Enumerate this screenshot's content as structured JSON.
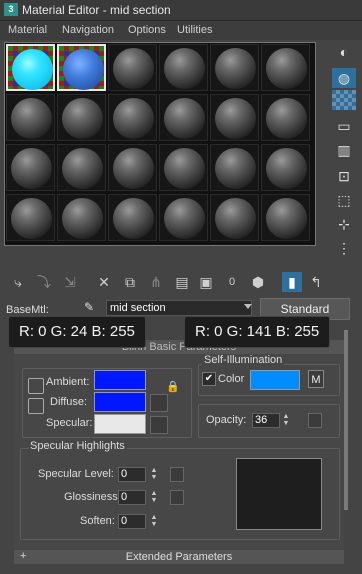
{
  "window": {
    "title": "Material Editor - mid section",
    "app_icon_text": "3"
  },
  "menu": {
    "items": [
      "Material",
      "Navigation",
      "Options",
      "Utilities"
    ]
  },
  "material": {
    "base_label": "BaseMtl:",
    "name": "mid section",
    "type_button": "Standard"
  },
  "rollout": {
    "header": "Blinn Basic Parameters",
    "ambient_label": "Ambient:",
    "diffuse_label": "Diffuse:",
    "specular_label": "Specular:",
    "self_illum": {
      "title": "Self-Illumination",
      "color_label": "Color",
      "checked": true,
      "map_button": "M"
    },
    "opacity_label": "Opacity:",
    "opacity_value": "36",
    "specular_highlights": {
      "title": "Specular Highlights",
      "level_label": "Specular Level:",
      "level_value": "0",
      "glossiness_label": "Glossiness:",
      "glossiness_value": "0",
      "soften_label": "Soften:",
      "soften_value": "0"
    },
    "colors": {
      "ambient": "#0018ff",
      "diffuse": "#0018ff",
      "specular": "#e8e8e8",
      "self_illum": "#008dff"
    }
  },
  "extended_parameters": {
    "label": "Extended Parameters",
    "expander": "+"
  },
  "tooltips": {
    "left": "R: 0 G: 24 B: 255",
    "right": "R: 0 G: 141 B: 255"
  },
  "toolbar": {
    "zero_label": "0"
  },
  "icons": {
    "right_tools": [
      "sample-type-icon",
      "backlight-icon",
      "background-checker-icon",
      "sample-uv-icon",
      "video-color-check-icon",
      "make-preview-icon",
      "options-icon",
      "select-by-material-icon",
      "material-map-navigator-icon"
    ],
    "bottom_tools": [
      "get-material-icon",
      "put-to-scene-icon",
      "assign-to-selection-icon",
      "reset-map-icon",
      "make-copy-icon",
      "make-unique-icon",
      "put-to-library-icon",
      "material-id-channel-icon",
      "show-map-in-viewport-icon",
      "show-end-result-icon",
      "go-to-parent-icon",
      "go-forward-icon"
    ]
  }
}
